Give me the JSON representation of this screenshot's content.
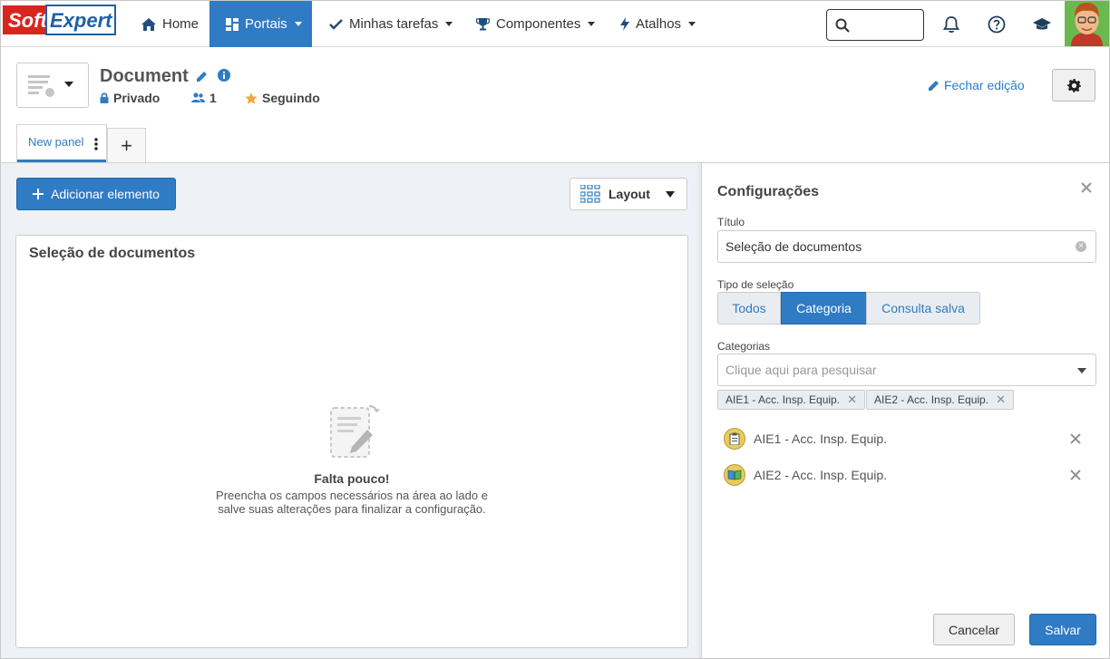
{
  "brand": {
    "logo_soft": "Soft",
    "logo_expert": "Expert",
    "primary": "#2f7bc4",
    "logo_red": "#d7261e"
  },
  "nav": {
    "home": "Home",
    "portals": "Portais",
    "tasks": "Minhas tarefas",
    "components": "Componentes",
    "shortcuts": "Atalhos",
    "search_placeholder": ""
  },
  "header": {
    "title": "Document",
    "privacy": "Privado",
    "members": "1",
    "following": "Seguindo",
    "close_edit": "Fechar edição"
  },
  "tabs": {
    "active": "New panel",
    "add": "+"
  },
  "toolbar": {
    "add_element": "Adicionar elemento",
    "layout": "Layout"
  },
  "panel": {
    "title": "Seleção de documentos",
    "empty_title": "Falta pouco!",
    "empty_text_1": "Preencha os campos necessários na área ao lado e",
    "empty_text_2": "salve suas alterações para finalizar a configuração."
  },
  "config": {
    "title": "Configurações",
    "title_label": "Título",
    "title_value": "Seleção de documentos",
    "selection_label": "Tipo de seleção",
    "selection_options": [
      "Todos",
      "Categoria",
      "Consulta salva"
    ],
    "selection_selected": "Categoria",
    "categories_label": "Categorias",
    "categories_placeholder": "Clique aqui para pesquisar",
    "chips": [
      "AIE1 - Acc. Insp. Equip.",
      "AIE2 - Acc. Insp. Equip."
    ],
    "items": [
      "AIE1 - Acc. Insp. Equip.",
      "AIE2 - Acc. Insp. Equip."
    ],
    "cancel": "Cancelar",
    "save": "Salvar"
  }
}
